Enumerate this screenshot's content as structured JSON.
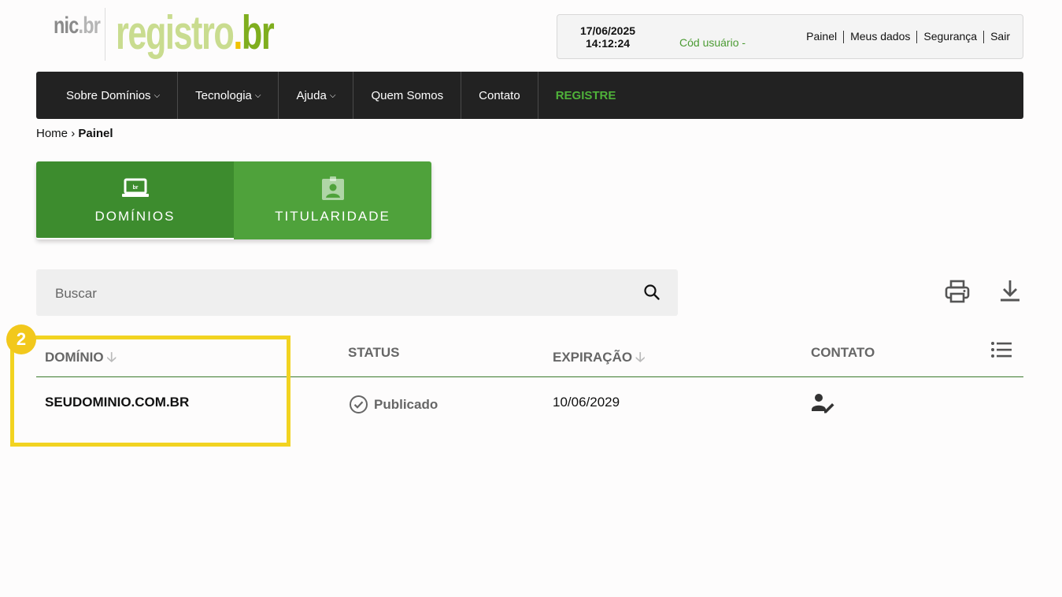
{
  "logo": {
    "nic_text": "nic",
    "nic_suffix": ".br",
    "brand_text": "registro",
    "brand_dot": ".",
    "brand_suffix": "br"
  },
  "userbox": {
    "date": "17/06/2025",
    "time": "14:12:24",
    "user_code": "Cód usuário -",
    "links": [
      "Painel",
      "Meus dados",
      "Segurança",
      "Sair"
    ]
  },
  "nav": {
    "items": [
      {
        "label": "Sobre Domínios",
        "dropdown": true
      },
      {
        "label": "Tecnologia",
        "dropdown": true
      },
      {
        "label": "Ajuda",
        "dropdown": true
      },
      {
        "label": "Quem Somos",
        "dropdown": false
      },
      {
        "label": "Contato",
        "dropdown": false
      },
      {
        "label": "REGISTRE",
        "dropdown": false
      }
    ]
  },
  "breadcrumb": {
    "home": "Home",
    "separator": "›",
    "current": "Painel"
  },
  "tabs": [
    {
      "label": "DOMÍNIOS",
      "icon": "laptop-br-icon",
      "active": true
    },
    {
      "label": "TITULARIDADE",
      "icon": "badge-person-icon",
      "active": false
    }
  ],
  "search": {
    "placeholder": "Buscar",
    "value": ""
  },
  "toolbar": {
    "print_icon": "print-icon",
    "download_icon": "download-icon"
  },
  "table": {
    "headers": {
      "domain": "DOMÍNIO",
      "status": "STATUS",
      "expiration": "EXPIRAÇÃO",
      "contact": "CONTATO"
    },
    "rows": [
      {
        "domain": "SEUDOMINIO.COM.BR",
        "status": "Publicado",
        "expiration": "10/06/2029",
        "contact_icon": "person-edit-icon"
      }
    ]
  },
  "annotation": {
    "badge": "2"
  },
  "colors": {
    "brand_green": "#3d8c2e",
    "tab_green": "#4fa23b",
    "nav_dark": "#222222",
    "highlight": "#f2d321",
    "registre": "#4fb23a"
  }
}
